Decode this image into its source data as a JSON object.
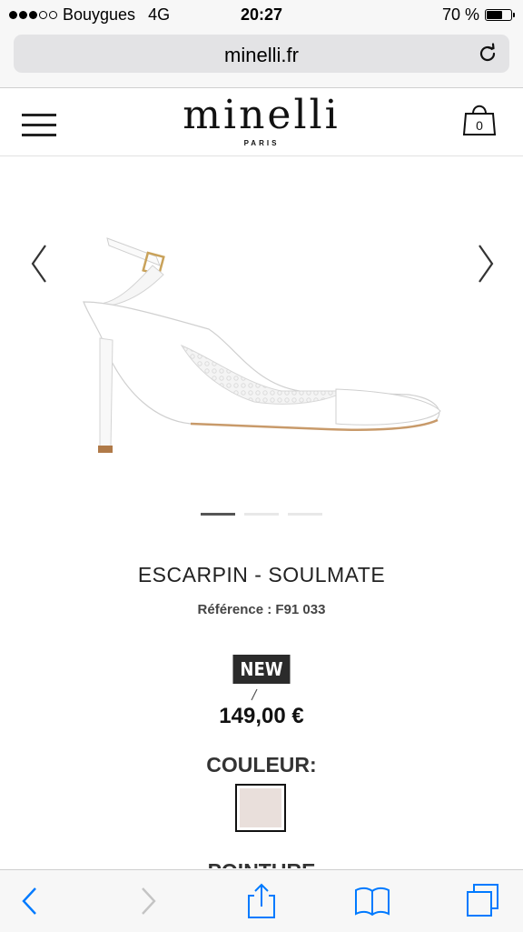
{
  "status_bar": {
    "carrier": "Bouygues",
    "network": "4G",
    "time": "20:27",
    "battery": "70 %",
    "battery_level": 0.7,
    "signal_bars": 3
  },
  "browser": {
    "url": "minelli.fr"
  },
  "header": {
    "logo": "minelli",
    "logo_sub": "PARIS",
    "cart_count": "0"
  },
  "carousel": {
    "slide_count": 3,
    "active_index": 0
  },
  "product": {
    "title": "ESCARPIN - SOULMATE",
    "reference": "Référence : F91 033",
    "badge": "NEW",
    "price": "149,00 €",
    "color_label": "COULEUR:",
    "swatch_color": "#e9dfdb",
    "size_label": "POINTURE"
  },
  "colors": {
    "accent": "#007aff",
    "badge_bg": "#2b2b2b"
  },
  "toolbar": {
    "icons": [
      "back-icon",
      "forward-icon",
      "share-icon",
      "bookmarks-icon",
      "tabs-icon"
    ]
  }
}
